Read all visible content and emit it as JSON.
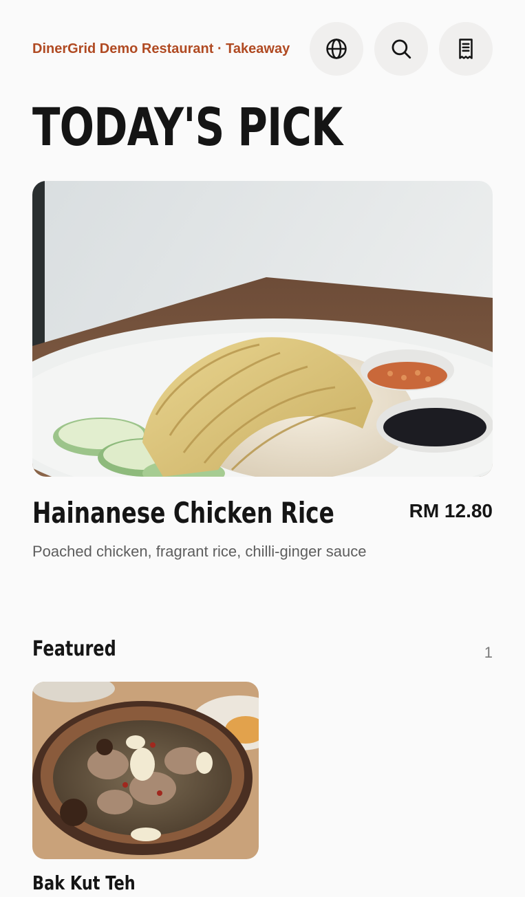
{
  "header": {
    "restaurant_name": "DinerGrid Demo Restaurant · Takeaway",
    "icons": [
      "globe-icon",
      "search-icon",
      "receipt-icon"
    ],
    "accent_color": "#b04a22"
  },
  "hero": {
    "title": "TODAY'S PICK",
    "dish_name": "Hainanese Chicken Rice",
    "price": "RM 12.80",
    "description": "Poached chicken, fragrant rice, chilli-ginger sauce"
  },
  "featured": {
    "title": "Featured",
    "count": "1",
    "items": [
      {
        "name": "Bak Kut Teh"
      }
    ]
  }
}
